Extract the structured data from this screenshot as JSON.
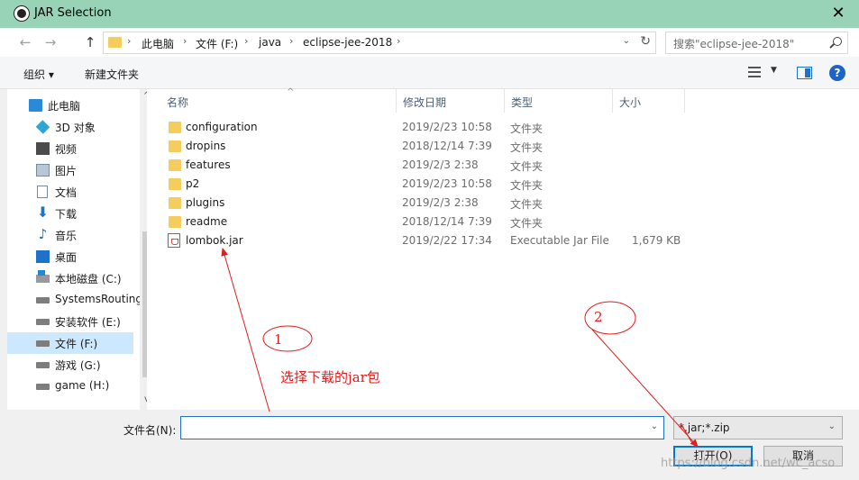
{
  "window": {
    "title": "JAR Selection",
    "close": "✕"
  },
  "nav_buttons": {
    "back": "←",
    "forward": "→",
    "up": "↑"
  },
  "breadcrumb": [
    "此电脑",
    "文件 (F:)",
    "java",
    "eclipse-jee-2018"
  ],
  "breadcrumb_sep": "›",
  "search": {
    "placeholder": "搜索\"eclipse-jee-2018\""
  },
  "toolbar": {
    "organize": "组织 ▾",
    "new_folder": "新建文件夹",
    "help": "?"
  },
  "sidebar": {
    "items": [
      {
        "label": "此电脑",
        "icon": "computer-icon"
      },
      {
        "label": "3D 对象",
        "icon": "cube-icon"
      },
      {
        "label": "视频",
        "icon": "video-icon"
      },
      {
        "label": "图片",
        "icon": "pictures-icon"
      },
      {
        "label": "文档",
        "icon": "document-icon"
      },
      {
        "label": "下载",
        "icon": "download-icon"
      },
      {
        "label": "音乐",
        "icon": "music-icon"
      },
      {
        "label": "桌面",
        "icon": "desktop-icon"
      },
      {
        "label": "本地磁盘 (C:)",
        "icon": "windows-drive-icon"
      },
      {
        "label": "SystemsRouting",
        "icon": "drive-icon"
      },
      {
        "label": "安装软件 (E:)",
        "icon": "drive-icon"
      },
      {
        "label": "文件 (F:)",
        "icon": "drive-icon",
        "selected": true
      },
      {
        "label": "游戏 (G:)",
        "icon": "drive-icon"
      },
      {
        "label": "game (H:)",
        "icon": "drive-icon"
      }
    ]
  },
  "columns": {
    "name": "名称",
    "modified": "修改日期",
    "type": "类型",
    "size": "大小"
  },
  "files": [
    {
      "name": "configuration",
      "modified": "2019/2/23 10:58",
      "type": "文件夹",
      "size": "",
      "icon": "folder-icon"
    },
    {
      "name": "dropins",
      "modified": "2018/12/14 7:39",
      "type": "文件夹",
      "size": "",
      "icon": "folder-icon"
    },
    {
      "name": "features",
      "modified": "2019/2/3 2:38",
      "type": "文件夹",
      "size": "",
      "icon": "folder-icon"
    },
    {
      "name": "p2",
      "modified": "2019/2/23 10:58",
      "type": "文件夹",
      "size": "",
      "icon": "folder-icon"
    },
    {
      "name": "plugins",
      "modified": "2019/2/3 2:38",
      "type": "文件夹",
      "size": "",
      "icon": "folder-icon"
    },
    {
      "name": "readme",
      "modified": "2018/12/14 7:39",
      "type": "文件夹",
      "size": "",
      "icon": "folder-icon"
    },
    {
      "name": "lombok.jar",
      "modified": "2019/2/22 17:34",
      "type": "Executable Jar File",
      "size": "1,679 KB",
      "icon": "jar-file-icon"
    }
  ],
  "bottom": {
    "filename_label": "文件名(N):",
    "filename_value": "",
    "filter": "*.jar;*.zip",
    "open": "打开(O)",
    "cancel": "取消"
  },
  "annotations": {
    "marker1": "1",
    "marker2": "2",
    "note": "选择下载的jar包",
    "color": "#e31c1c"
  },
  "watermark": "https://blog.csdn.net/wc_acso"
}
